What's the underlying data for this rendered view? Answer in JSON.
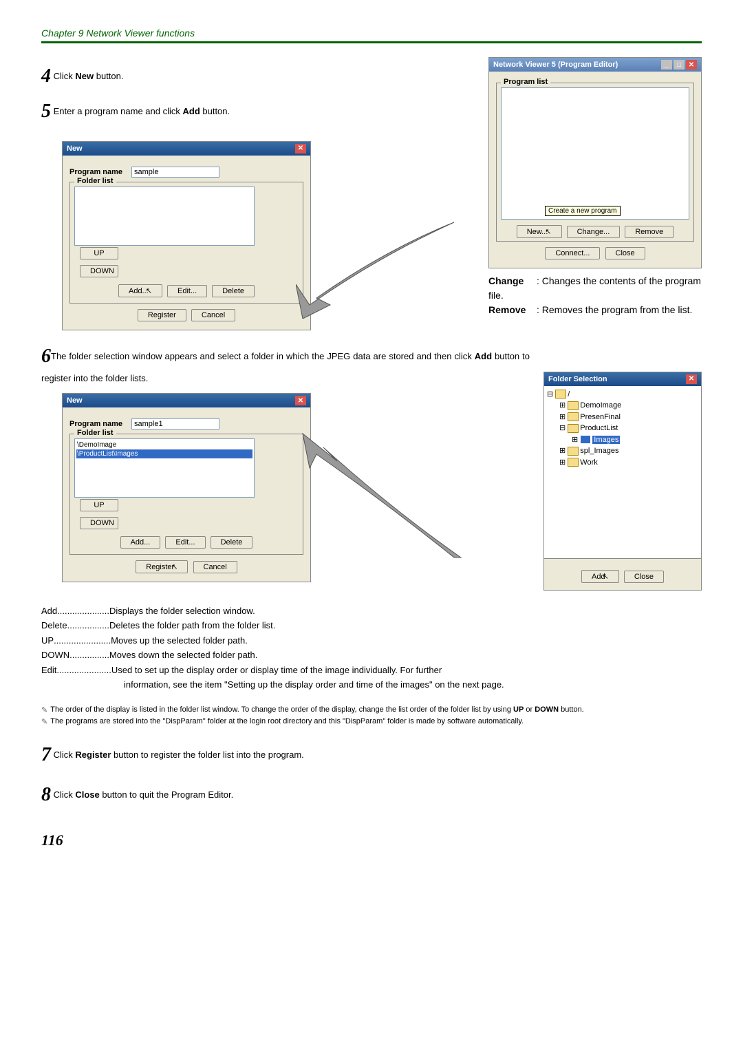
{
  "header": "Chapter 9 Network Viewer functions",
  "steps": {
    "s4": {
      "num": "4",
      "text_a": " Click ",
      "bold": "New",
      "text_b": " button."
    },
    "s5": {
      "num": "5",
      "text_a": " Enter a program name and click ",
      "bold": "Add",
      "text_b": " button."
    },
    "s6": {
      "num": "6",
      "text_a": "The folder selection window appears and select a folder in which the JPEG data are stored and then click ",
      "bold": "Add",
      "text_b": " button to register into the folder lists."
    },
    "s7": {
      "num": "7",
      "text_a": " Click ",
      "bold": "Register",
      "text_b": " button to register the folder list into the program."
    },
    "s8": {
      "num": "8",
      "text_a": " Click ",
      "bold": "Close",
      "text_b": " button to quit the Program Editor."
    }
  },
  "new_dialog1": {
    "title": "New",
    "program_name_label": "Program name",
    "program_name_value": "sample",
    "folder_list_label": "Folder list",
    "up": "UP",
    "down": "DOWN",
    "add": "Add...",
    "edit": "Edit...",
    "delete": "Delete",
    "register": "Register",
    "cancel": "Cancel"
  },
  "new_dialog2": {
    "title": "New",
    "program_name_label": "Program name",
    "program_name_value": "sample1",
    "folder_list_label": "Folder list",
    "items": [
      "\\DemoImage",
      "\\ProductList\\Images"
    ],
    "up": "UP",
    "down": "DOWN",
    "add": "Add...",
    "edit": "Edit...",
    "delete": "Delete",
    "register": "Register",
    "cancel": "Cancel"
  },
  "program_editor": {
    "title": "Network Viewer 5 (Program Editor)",
    "program_list": "Program list",
    "new": "New...",
    "change": "Change...",
    "remove": "Remove",
    "tooltip": "Create a new program",
    "connect": "Connect...",
    "close": "Close"
  },
  "change_remove": {
    "change_label": "Change",
    "change_desc": ": Changes the contents of the program file.",
    "remove_label": "Remove",
    "remove_desc": ": Removes the program from the list."
  },
  "folder_selection": {
    "title": "Folder Selection",
    "root": "/",
    "items": [
      "DemoImage",
      "PresenFinal",
      "ProductList",
      "Images",
      "spl_Images",
      "Work"
    ],
    "add": "Add",
    "close": "Close"
  },
  "descriptions": [
    {
      "term": "Add",
      "dots": ".....................",
      "def": "Displays the folder selection window."
    },
    {
      "term": "Delete",
      "dots": ".................",
      "def": "Deletes the folder path from the folder list."
    },
    {
      "term": "UP",
      "dots": ".......................",
      "def": "Moves up the selected folder path."
    },
    {
      "term": "DOWN",
      "dots": "................",
      "def": "Moves down the selected folder path."
    },
    {
      "term": "Edit",
      "dots": "......................",
      "def": "Used to set up the display order or display time of the image individually. For further"
    }
  ],
  "desc_cont": "information, see the item \"Setting up the display order and time of the images\" on the next page.",
  "notes": [
    "The order of the display is listed in the folder list window. To change the order of the display, change the list order of the folder list by using UP or DOWN button.",
    "The programs are stored into the \"DispParam\" folder  at the login root directory and this \"DispParam\" folder is made by software automatically."
  ],
  "notes_bold": {
    "up": "UP",
    "down": "DOWN"
  },
  "page_num": "116"
}
